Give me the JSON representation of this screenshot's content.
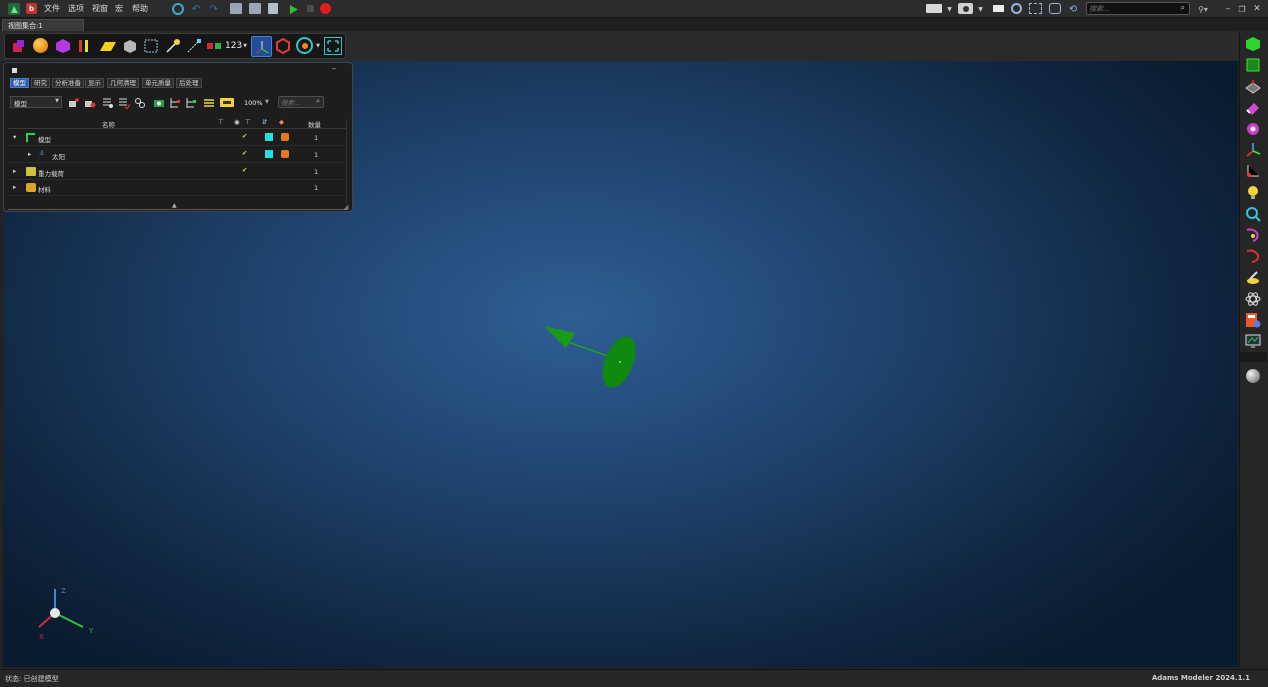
{
  "menu": [
    "文件",
    "选项",
    "视窗",
    "宏",
    "帮助"
  ],
  "doc_tab": "视图集合:1",
  "ribbon": {
    "counter_label": "123"
  },
  "search": {
    "placeholder": "搜索..."
  },
  "panel": {
    "tabs": [
      "模型",
      "研究",
      "分析准备",
      "显示",
      "几何清理",
      "单元质量",
      "后处理"
    ],
    "active_tab": "模型",
    "filter_value": "模型",
    "zoom": "100%",
    "search_placeholder": "搜索...",
    "columns": {
      "name": "名称",
      "count": "数量"
    },
    "rows": [
      {
        "label": "模型",
        "count": "1",
        "visible": true,
        "color": "#20e0e0"
      },
      {
        "label": "太阳",
        "count": "1",
        "visible": true,
        "color": "#20e0e0"
      },
      {
        "label": "重力载荷",
        "count": "1",
        "visible": true,
        "color": ""
      },
      {
        "label": "材料",
        "count": "1",
        "visible": false,
        "color": ""
      }
    ]
  },
  "triad": {
    "x": "X",
    "y": "Y",
    "z": "Z"
  },
  "status": {
    "left": "状态: 已创建模型",
    "right": "Adams Modeler 2024.1.1"
  },
  "colors": {
    "accent": "#2c5aa8",
    "arrow": "#1faa1f",
    "disk": "#0f8a0f"
  }
}
